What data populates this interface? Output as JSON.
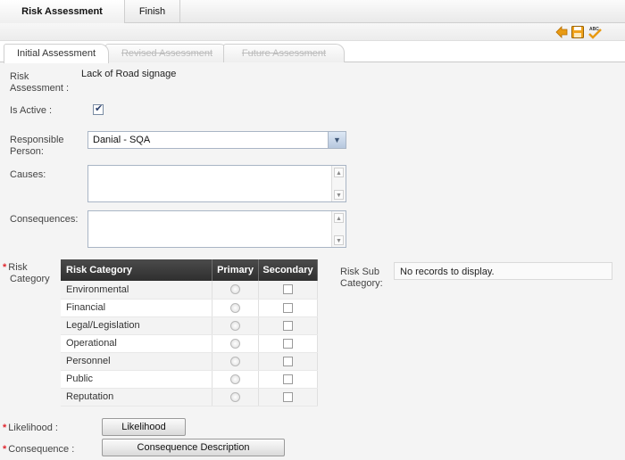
{
  "top_tabs": [
    {
      "label": "Risk Assessment",
      "active": true
    },
    {
      "label": "Finish",
      "active": false
    }
  ],
  "toolbar": {
    "back_icon": "arrow-left-icon",
    "save_icon": "floppy-disk-icon",
    "spellcheck_icon": "spellcheck-icon",
    "spellcheck_text": "ABC"
  },
  "sub_tabs": [
    {
      "label": "Initial Assessment",
      "active": true
    },
    {
      "label": "Revised Assessment",
      "active": false
    },
    {
      "label": "Future Assessment",
      "active": false
    }
  ],
  "form": {
    "risk_assessment_label_1": "Risk",
    "risk_assessment_label_2": "Assessment :",
    "risk_assessment_value": "Lack of Road signage",
    "is_active_label": "Is Active :",
    "is_active": true,
    "responsible_label_1": "Responsible",
    "responsible_label_2": "Person:",
    "responsible_value": "Danial - SQA",
    "causes_label": "Causes:",
    "consequences_label": "Consequences:",
    "risk_category_label_1": "Risk",
    "risk_category_label_2": "Category",
    "required_marker": "*"
  },
  "risk_table": {
    "headers": [
      "Risk Category",
      "Primary",
      "Secondary"
    ],
    "rows": [
      "Environmental",
      "Financial",
      "Legal/Legislation",
      "Operational",
      "Personnel",
      "Public",
      "Reputation"
    ]
  },
  "sub_category": {
    "label_1": "Risk Sub",
    "label_2": "Category:",
    "empty_text": "No records to display."
  },
  "likelihood": {
    "label": "Likelihood :",
    "button": "Likelihood"
  },
  "consequence": {
    "label": "Consequence :",
    "button": "Consequence Description"
  },
  "colors": {
    "header_dark": "#3a3a3a",
    "required_red": "#e0262e",
    "save_orange": "#e89a12"
  }
}
